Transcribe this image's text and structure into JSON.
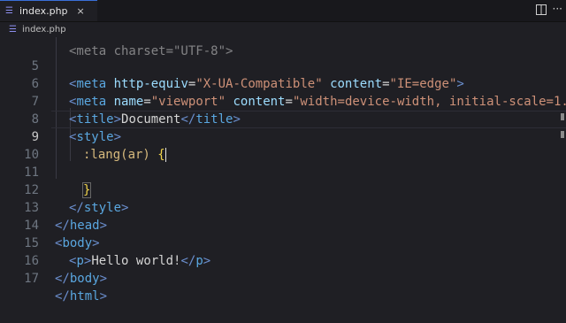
{
  "tab": {
    "label": "index.php",
    "close": "×"
  },
  "breadcrumb": {
    "file": "index.php"
  },
  "toolbar": {
    "more": "···"
  },
  "icons": {
    "file_icon": "php-file-icon",
    "split": "split-editor-icon",
    "more": "more-actions-icon"
  },
  "editor": {
    "top_partial": "<meta charset=\"UTF-8\">",
    "lines": [
      {
        "num": "5",
        "text": "<meta http-equiv=\"X-UA-Compatible\" content=\"IE=edge\">"
      },
      {
        "num": "6",
        "text": "<meta name=\"viewport\" content=\"width=device-width, initial-scale=1.0\">"
      },
      {
        "num": "7",
        "text": "<title>Document</title>"
      },
      {
        "num": "8",
        "text": "<style>"
      },
      {
        "num": "9",
        "text": ":lang(ar) {"
      },
      {
        "num": "10",
        "text": ""
      },
      {
        "num": "11",
        "text": "}"
      },
      {
        "num": "12",
        "text": "</style>"
      },
      {
        "num": "13",
        "text": "</head>"
      },
      {
        "num": "14",
        "text": "<body>"
      },
      {
        "num": "15",
        "text": "<p>Hello world!</p>"
      },
      {
        "num": "16",
        "text": "</body>"
      },
      {
        "num": "17",
        "text": "</html>"
      }
    ],
    "active_line": "9"
  }
}
